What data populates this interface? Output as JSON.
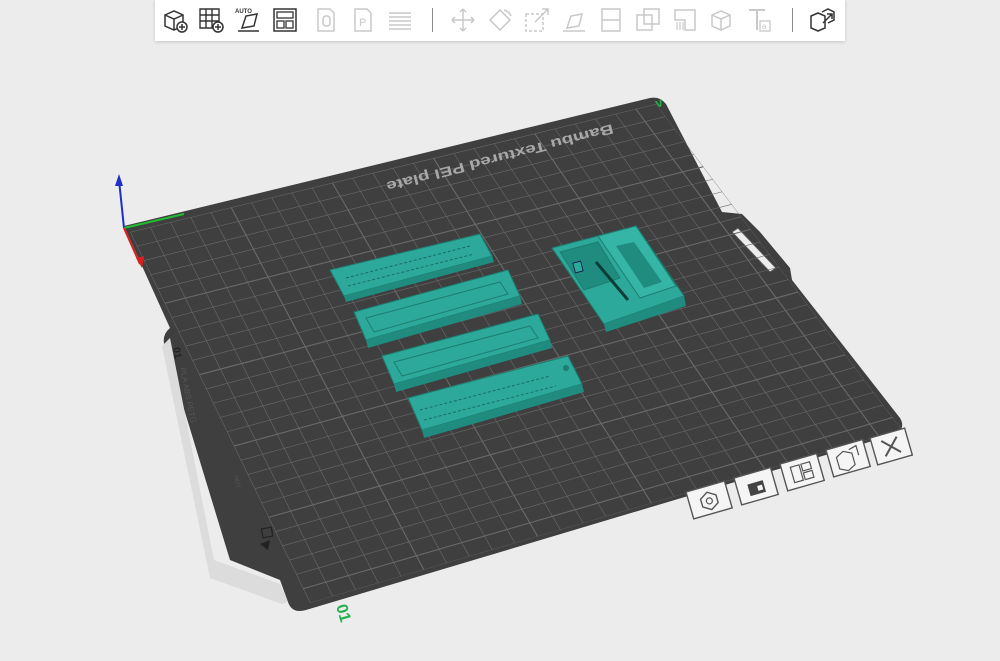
{
  "toolbar": {
    "buttons": [
      {
        "name": "add-object-icon",
        "enabled": true
      },
      {
        "name": "add-plate-icon",
        "enabled": true
      },
      {
        "name": "auto-orient-icon",
        "enabled": true,
        "label": "AUTO"
      },
      {
        "name": "arrange-icon",
        "enabled": true
      },
      {
        "name": "split-objects-icon",
        "enabled": false
      },
      {
        "name": "split-parts-icon",
        "enabled": false,
        "label": "P"
      },
      {
        "name": "layers-icon",
        "enabled": false
      },
      {
        "name": "move-icon",
        "enabled": false
      },
      {
        "name": "rotate-icon",
        "enabled": false
      },
      {
        "name": "scale-icon",
        "enabled": false
      },
      {
        "name": "lay-on-face-icon",
        "enabled": false
      },
      {
        "name": "cut-icon",
        "enabled": false
      },
      {
        "name": "boolean-icon",
        "enabled": false
      },
      {
        "name": "support-paint-icon",
        "enabled": false
      },
      {
        "name": "seam-paint-icon",
        "enabled": false
      },
      {
        "name": "text-emboss-icon",
        "enabled": false,
        "label": "a"
      },
      {
        "name": "assembly-view-icon",
        "enabled": true
      }
    ]
  },
  "plate": {
    "label": "Bambu Textured PEI plate",
    "axis_label_top": "v",
    "axis_label_bottom": "01",
    "side_label_number": "01",
    "side_label_material": "PLA ABS PETG",
    "side_label_small": "HOT"
  },
  "colors": {
    "background": "#ececec",
    "plate": "#3f3f3f",
    "grid": "#6a6a6a",
    "model": "#2ca99a",
    "axis_x": "#d92020",
    "axis_y": "#22bb33",
    "axis_z": "#1f2fc8",
    "origin_label": "#22b04a"
  },
  "plate_controls": [
    {
      "name": "plate-orient-icon"
    },
    {
      "name": "plate-lock-icon"
    },
    {
      "name": "plate-arrange-icon"
    },
    {
      "name": "plate-settings-icon"
    },
    {
      "name": "plate-delete-icon"
    }
  ]
}
